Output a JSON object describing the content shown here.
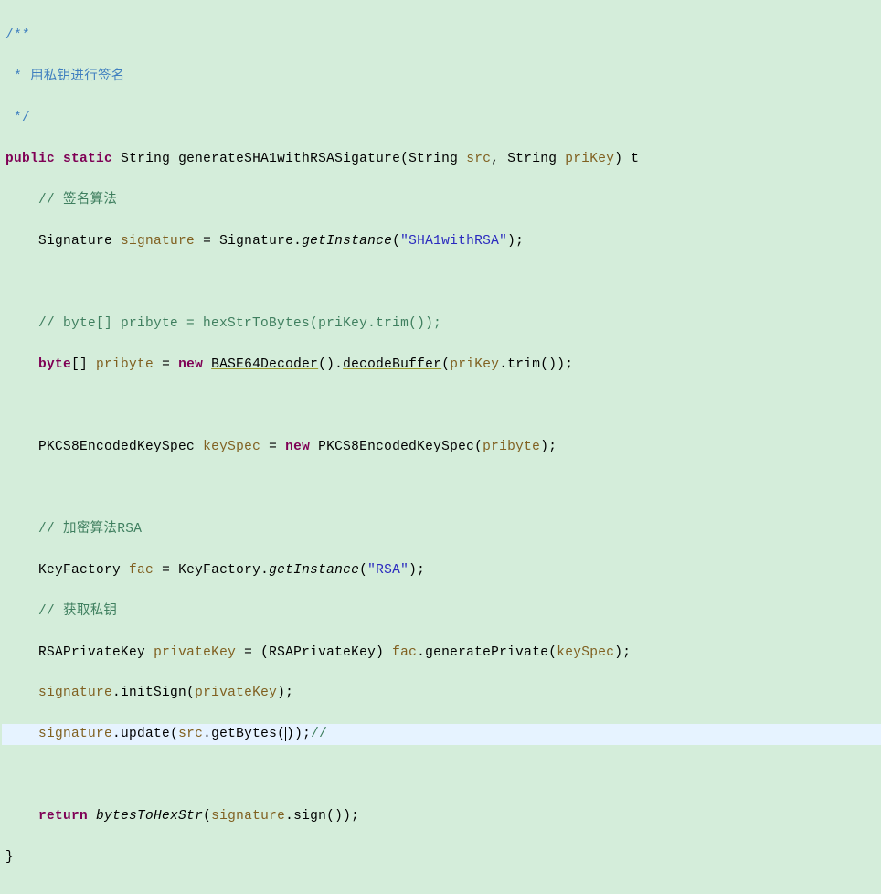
{
  "lines": {
    "c1": "/**",
    "c2": " * 用私钥进行签名",
    "c3": " */",
    "kw_public": "public",
    "kw_static": "static",
    "kw_new": "new",
    "kw_return": "return",
    "type_string": "String",
    "type_byte": "byte",
    "method_name": "generateSHA1withRSASigature",
    "param_src": "src",
    "param_prikey": "priKey",
    "sig_class": "Signature",
    "sig_var": "signature",
    "getinstance": "getInstance",
    "sha_str": "\"SHA1withRSA\"",
    "cmt_sign_algo": "// 签名算法",
    "cmt_hex_pribyte": "// byte[] pribyte = hexStrToBytes(priKey.trim());",
    "pribyte": "pribyte",
    "base64": "BASE64Decoder",
    "decodebuffer": "decodeBuffer",
    "trim": "trim",
    "pkcs": "PKCS8EncodedKeySpec",
    "keyspec": "keySpec",
    "cmt_rsa": "// 加密算法RSA",
    "keyfactory": "KeyFactory",
    "fac": "fac",
    "rsa_str": "\"RSA\"",
    "cmt_get_pri": "// 获取私钥",
    "rsapriv": "RSAPrivateKey",
    "privatekey": "privateKey",
    "genprivate": "generatePrivate",
    "initsign": "initSign",
    "update": "update",
    "getbytes": "getBytes",
    "bytestohex": "bytesToHexStr",
    "sign": "sign",
    "tail_cmt": "//",
    "tail_t": "t"
  }
}
